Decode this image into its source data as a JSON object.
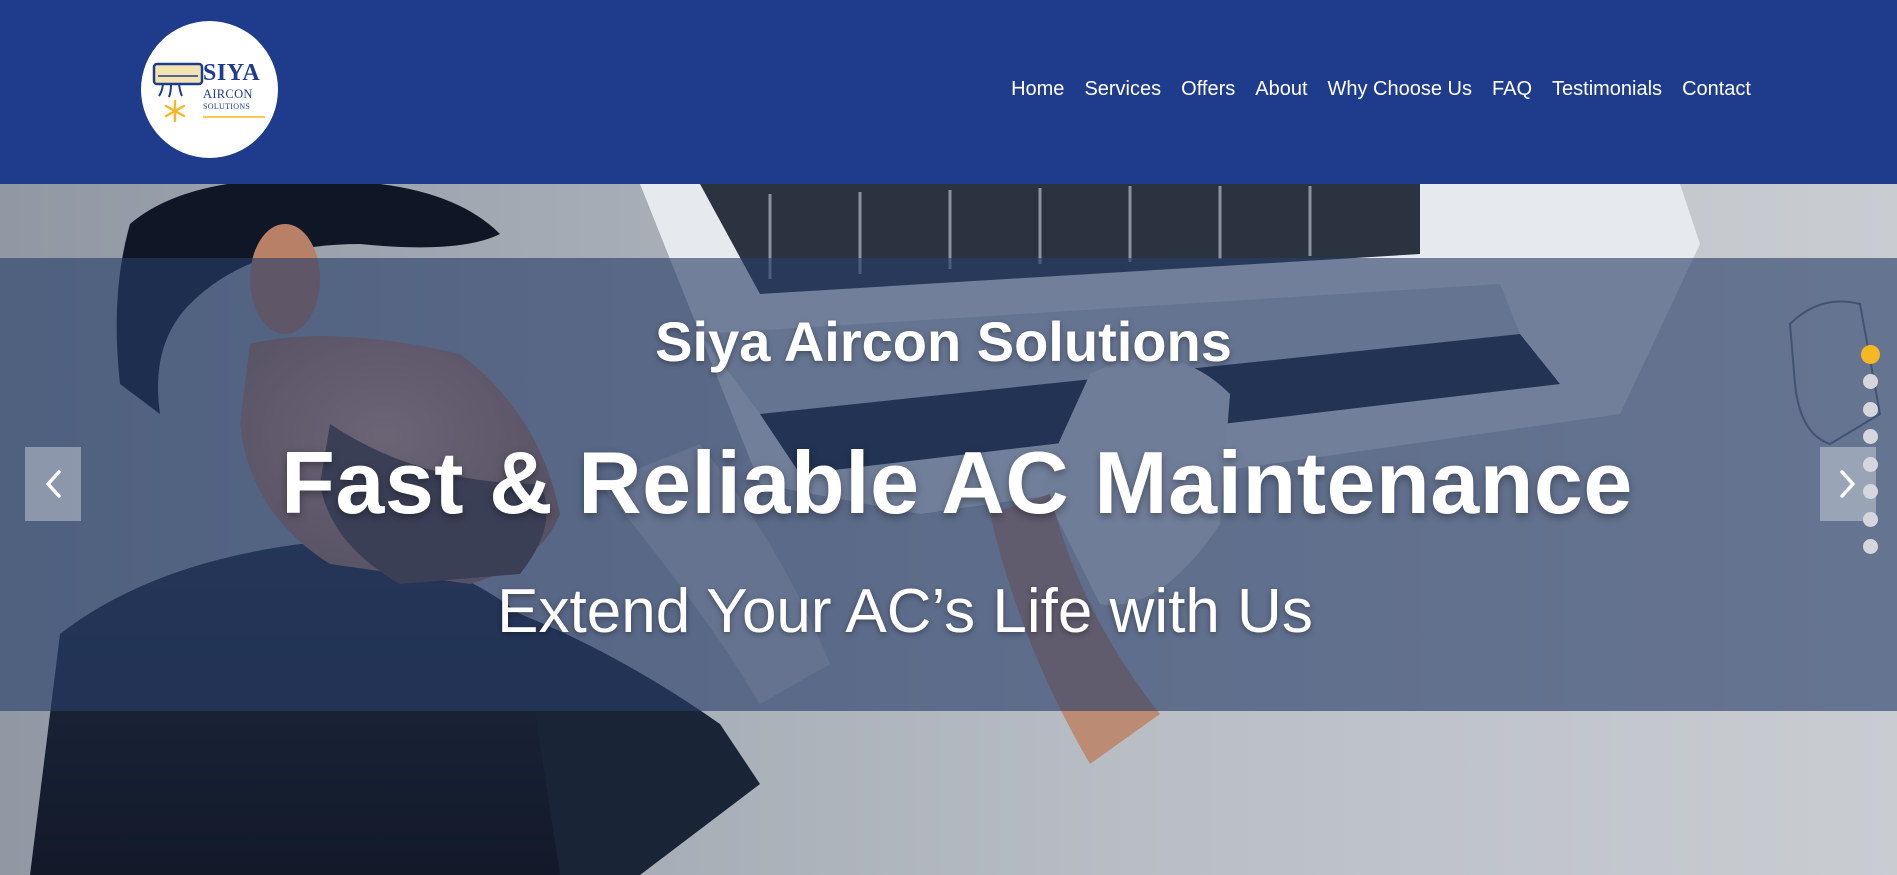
{
  "logo": {
    "brand": "SIYA",
    "line1": "AIRCON",
    "line2": "SOLUTIONS",
    "icon": "ac-snowflake-icon"
  },
  "nav": {
    "items": [
      {
        "label": "Home"
      },
      {
        "label": "Services"
      },
      {
        "label": "Offers"
      },
      {
        "label": "About"
      },
      {
        "label": "Why Choose Us"
      },
      {
        "label": "FAQ"
      },
      {
        "label": "Testimonials"
      },
      {
        "label": "Contact"
      }
    ]
  },
  "hero": {
    "brand": "Siya Aircon Solutions",
    "title": "Fast & Reliable AC Maintenance",
    "subtitle": "Extend Your AC’s Life with Us",
    "image": "technician-servicing-ac-photo",
    "prev_icon": "chevron-left-icon",
    "next_icon": "chevron-right-icon",
    "slide_count": 8,
    "active_slide": 1
  },
  "colors": {
    "header_bg": "#1f3c8c",
    "active_dot": "#f5b823",
    "inactive_dot": "#d5d7dc",
    "text": "#ffffff"
  }
}
